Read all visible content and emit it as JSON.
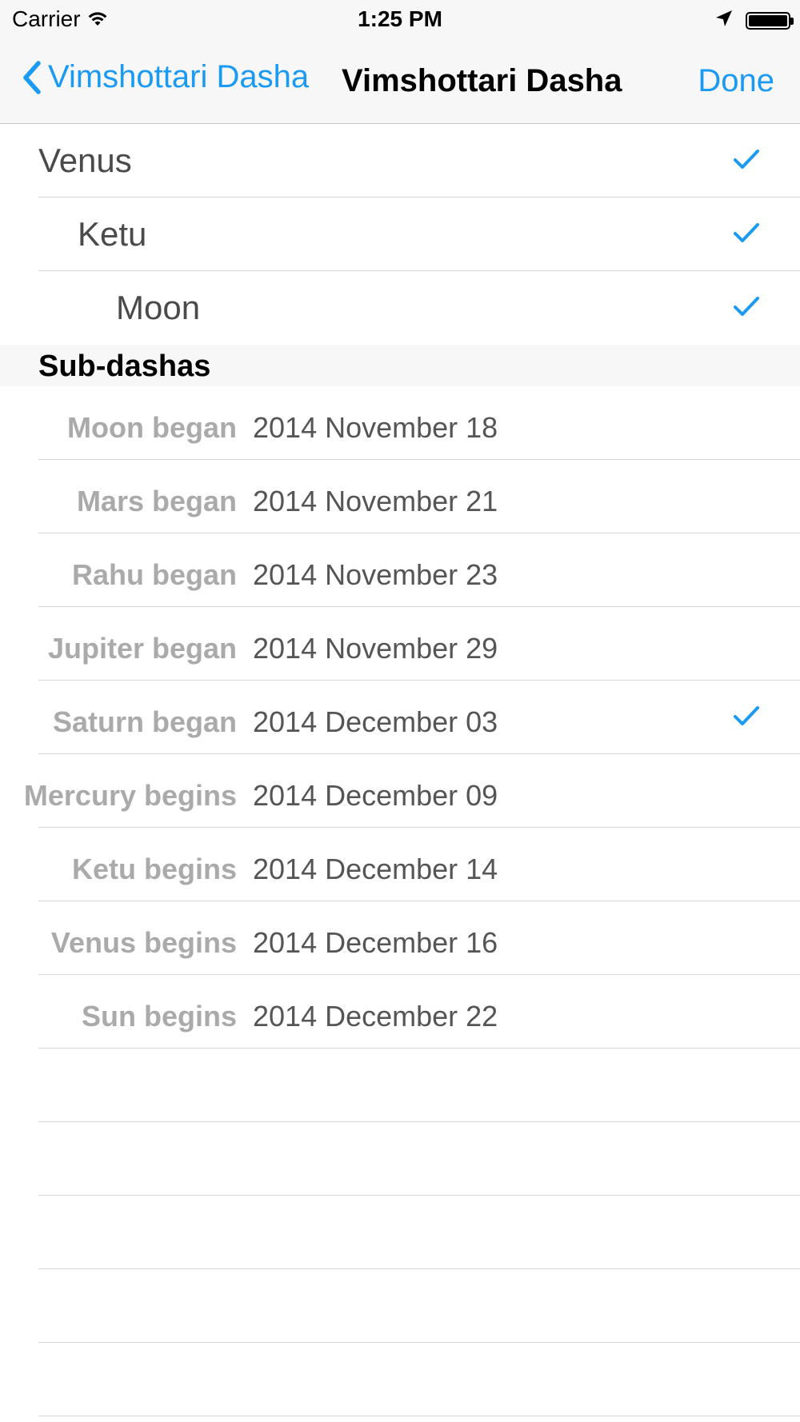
{
  "status_bar": {
    "carrier": "Carrier",
    "time": "1:25 PM"
  },
  "nav": {
    "back_label": "Vimshottari Dasha",
    "title": "Vimshottari Dasha",
    "done_label": "Done"
  },
  "colors": {
    "tint": "#1a9af2",
    "secondary_text": "#aaaaaa"
  },
  "levels": [
    {
      "label": "Venus",
      "checked": true
    },
    {
      "label": "Ketu",
      "checked": true
    },
    {
      "label": "Moon",
      "checked": true
    }
  ],
  "section": {
    "title": "Sub-dashas"
  },
  "subdashas": [
    {
      "label": "Moon began",
      "date": "2014 November 18",
      "checked": false
    },
    {
      "label": "Mars began",
      "date": "2014 November 21",
      "checked": false
    },
    {
      "label": "Rahu began",
      "date": "2014 November 23",
      "checked": false
    },
    {
      "label": "Jupiter began",
      "date": "2014 November 29",
      "checked": false
    },
    {
      "label": "Saturn began",
      "date": "2014 December 03",
      "checked": true
    },
    {
      "label": "Mercury begins",
      "date": "2014 December 09",
      "checked": false
    },
    {
      "label": "Ketu begins",
      "date": "2014 December 14",
      "checked": false
    },
    {
      "label": "Venus begins",
      "date": "2014 December 16",
      "checked": false
    },
    {
      "label": "Sun begins",
      "date": "2014 December 22",
      "checked": false
    }
  ]
}
